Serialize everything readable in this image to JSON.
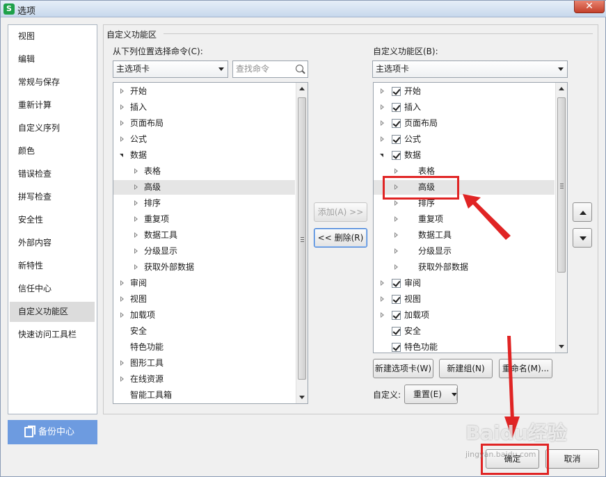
{
  "window": {
    "title": "选项",
    "app_icon_letter": "S",
    "close_glyph": "✕"
  },
  "nav": {
    "items": [
      "视图",
      "编辑",
      "常规与保存",
      "重新计算",
      "自定义序列",
      "颜色",
      "错误检查",
      "拼写检查",
      "安全性",
      "外部内容",
      "新特性",
      "信任中心",
      "自定义功能区",
      "快速访问工具栏"
    ],
    "selected": "自定义功能区",
    "backup_label": "备份中心"
  },
  "group": {
    "title": "自定义功能区"
  },
  "left": {
    "label": "从下列位置选择命令(C):",
    "combo_value": "主选项卡",
    "search_placeholder": "查找命令",
    "rows": [
      {
        "text": "开始",
        "level": 0,
        "expander": "right"
      },
      {
        "text": "插入",
        "level": 0,
        "expander": "right"
      },
      {
        "text": "页面布局",
        "level": 0,
        "expander": "right"
      },
      {
        "text": "公式",
        "level": 0,
        "expander": "right"
      },
      {
        "text": "数据",
        "level": 0,
        "expander": "down"
      },
      {
        "text": "表格",
        "level": 1,
        "expander": "right"
      },
      {
        "text": "高级",
        "level": 1,
        "expander": "right",
        "highlight": true
      },
      {
        "text": "排序",
        "level": 1,
        "expander": "right"
      },
      {
        "text": "重复项",
        "level": 1,
        "expander": "right"
      },
      {
        "text": "数据工具",
        "level": 1,
        "expander": "right"
      },
      {
        "text": "分级显示",
        "level": 1,
        "expander": "right"
      },
      {
        "text": "获取外部数据",
        "level": 1,
        "expander": "right"
      },
      {
        "text": "审阅",
        "level": 0,
        "expander": "right"
      },
      {
        "text": "视图",
        "level": 0,
        "expander": "right"
      },
      {
        "text": "加载项",
        "level": 0,
        "expander": "right"
      },
      {
        "text": "安全",
        "level": 0,
        "expander": "none"
      },
      {
        "text": "特色功能",
        "level": 0,
        "expander": "none"
      },
      {
        "text": "图形工具",
        "level": 0,
        "expander": "right"
      },
      {
        "text": "在线资源",
        "level": 0,
        "expander": "right"
      },
      {
        "text": "智能工具箱",
        "level": 0,
        "expander": "none"
      }
    ]
  },
  "middle": {
    "add_label": "添加(A) >>",
    "remove_label": "<< 删除(R)"
  },
  "right": {
    "label": "自定义功能区(B):",
    "combo_value": "主选项卡",
    "rows": [
      {
        "text": "开始",
        "level": 0,
        "expander": "right",
        "checked": true
      },
      {
        "text": "插入",
        "level": 0,
        "expander": "right",
        "checked": true
      },
      {
        "text": "页面布局",
        "level": 0,
        "expander": "right",
        "checked": true
      },
      {
        "text": "公式",
        "level": 0,
        "expander": "right",
        "checked": true
      },
      {
        "text": "数据",
        "level": 0,
        "expander": "down",
        "checked": true
      },
      {
        "text": "表格",
        "level": 1,
        "expander": "right"
      },
      {
        "text": "高级",
        "level": 1,
        "expander": "right",
        "highlight": true
      },
      {
        "text": "排序",
        "level": 1,
        "expander": "right"
      },
      {
        "text": "重复项",
        "level": 1,
        "expander": "right"
      },
      {
        "text": "数据工具",
        "level": 1,
        "expander": "right"
      },
      {
        "text": "分级显示",
        "level": 1,
        "expander": "right"
      },
      {
        "text": "获取外部数据",
        "level": 1,
        "expander": "right"
      },
      {
        "text": "审阅",
        "level": 0,
        "expander": "right",
        "checked": true
      },
      {
        "text": "视图",
        "level": 0,
        "expander": "right",
        "checked": true
      },
      {
        "text": "加载项",
        "level": 0,
        "expander": "right",
        "checked": true
      },
      {
        "text": "安全",
        "level": 0,
        "expander": "none",
        "checked": true
      },
      {
        "text": "特色功能",
        "level": 0,
        "expander": "none",
        "checked": true
      }
    ],
    "new_tab_label": "新建选项卡(W)",
    "new_group_label": "新建组(N)",
    "rename_label": "重命名(M)...",
    "customize_label": "自定义:",
    "reset_label": "重置(E)"
  },
  "footer": {
    "ok_label": "确定",
    "cancel_label": "取消"
  },
  "watermark": {
    "text": "Baidu经验",
    "sub": "jingyan.baidu.com"
  },
  "annotation": {
    "color": "#e02424"
  }
}
